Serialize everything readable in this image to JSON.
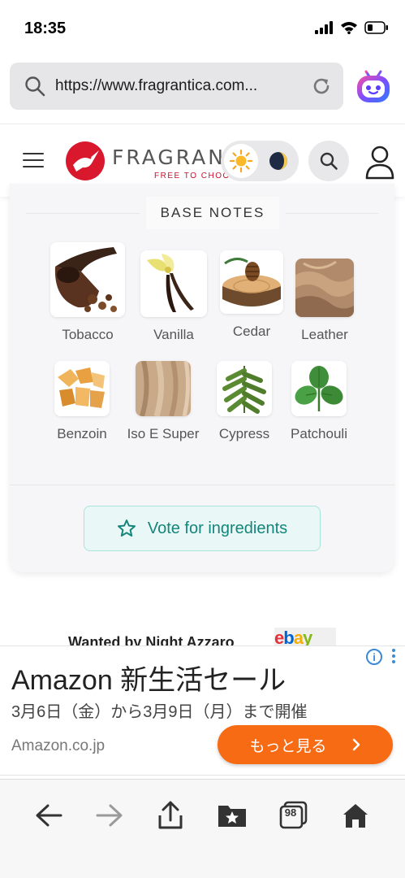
{
  "status": {
    "time": "18:35"
  },
  "browser": {
    "url": "https://www.fragrantica.com...",
    "tab_count": "98"
  },
  "site": {
    "logo_text": "FRAGRANTICA",
    "tagline": "FREE TO CHOOSE"
  },
  "notes_section": {
    "title": "BASE NOTES",
    "items": [
      {
        "label": "Tobacco"
      },
      {
        "label": "Vanilla"
      },
      {
        "label": "Cedar"
      },
      {
        "label": "Leather"
      },
      {
        "label": "Benzoin"
      },
      {
        "label": "Iso E Super"
      },
      {
        "label": "Cypress"
      },
      {
        "label": "Patchouli"
      }
    ],
    "vote_label": "Vote for ingredients"
  },
  "wanted": {
    "text": "Wanted by Night Azzaro",
    "partner": "ebay"
  },
  "ad": {
    "title": "Amazon 新生活セール",
    "subtitle": "3月6日（金）から3月9日（月）まで開催",
    "domain": "Amazon.co.jp",
    "cta": "もっと見る",
    "info_icon": "i"
  },
  "colors": {
    "accent_teal": "#14857a",
    "brand_red": "#c8102e",
    "cta_orange": "#f76b14"
  }
}
